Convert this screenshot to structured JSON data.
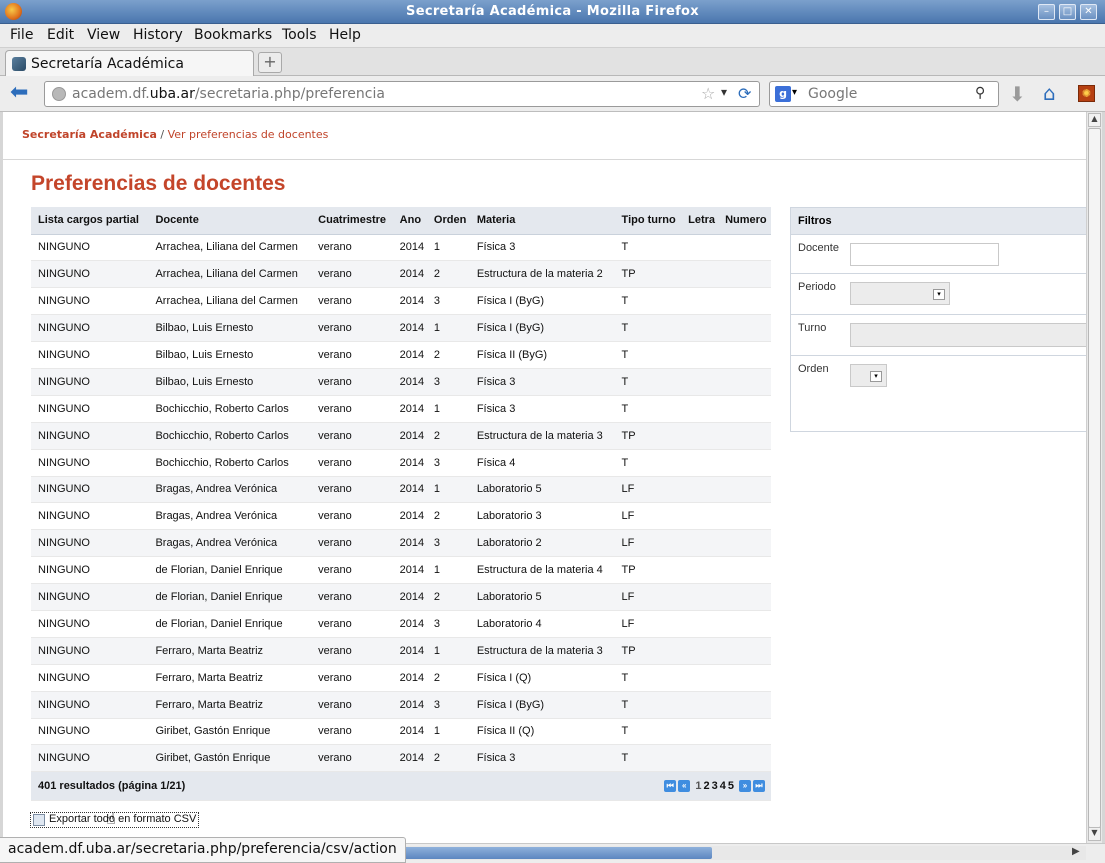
{
  "window": {
    "title": "Secretaría Académica - Mozilla Firefox"
  },
  "menu": [
    "File",
    "Edit",
    "View",
    "History",
    "Bookmarks",
    "Tools",
    "Help"
  ],
  "tab": {
    "title": "Secretaría Académica",
    "new_tab": "+"
  },
  "nav": {
    "url_prefix": "academ.df.",
    "url_host": "uba.ar",
    "url_path": "/secretaria.php/preferencia",
    "search_placeholder": "Google",
    "search_engine": "g"
  },
  "breadcrumb": {
    "root": "Secretaría Académica",
    "sep": " / ",
    "current": "Ver preferencias de docentes"
  },
  "page_title": "Preferencias de docentes",
  "table": {
    "columns": [
      "Lista cargos partial",
      "Docente",
      "Cuatrimestre",
      "Ano",
      "Orden",
      "Materia",
      "Tipo turno",
      "Letra",
      "Numero"
    ],
    "rows": [
      [
        "NINGUNO",
        "Arrachea, Liliana del Carmen",
        "verano",
        "2014",
        "1",
        "Física 3",
        "T",
        "",
        ""
      ],
      [
        "NINGUNO",
        "Arrachea, Liliana del Carmen",
        "verano",
        "2014",
        "2",
        "Estructura de la materia 2",
        "TP",
        "",
        ""
      ],
      [
        "NINGUNO",
        "Arrachea, Liliana del Carmen",
        "verano",
        "2014",
        "3",
        "Física I (ByG)",
        "T",
        "",
        ""
      ],
      [
        "NINGUNO",
        "Bilbao, Luis Ernesto",
        "verano",
        "2014",
        "1",
        "Física I (ByG)",
        "T",
        "",
        ""
      ],
      [
        "NINGUNO",
        "Bilbao, Luis Ernesto",
        "verano",
        "2014",
        "2",
        "Física II (ByG)",
        "T",
        "",
        ""
      ],
      [
        "NINGUNO",
        "Bilbao, Luis Ernesto",
        "verano",
        "2014",
        "3",
        "Física 3",
        "T",
        "",
        ""
      ],
      [
        "NINGUNO",
        "Bochicchio, Roberto Carlos",
        "verano",
        "2014",
        "1",
        "Física 3",
        "T",
        "",
        ""
      ],
      [
        "NINGUNO",
        "Bochicchio, Roberto Carlos",
        "verano",
        "2014",
        "2",
        "Estructura de la materia 3",
        "TP",
        "",
        ""
      ],
      [
        "NINGUNO",
        "Bochicchio, Roberto Carlos",
        "verano",
        "2014",
        "3",
        "Física 4",
        "T",
        "",
        ""
      ],
      [
        "NINGUNO",
        "Bragas, Andrea Verónica",
        "verano",
        "2014",
        "1",
        "Laboratorio 5",
        "LF",
        "",
        ""
      ],
      [
        "NINGUNO",
        "Bragas, Andrea Verónica",
        "verano",
        "2014",
        "2",
        "Laboratorio 3",
        "LF",
        "",
        ""
      ],
      [
        "NINGUNO",
        "Bragas, Andrea Verónica",
        "verano",
        "2014",
        "3",
        "Laboratorio 2",
        "LF",
        "",
        ""
      ],
      [
        "NINGUNO",
        "de Florian, Daniel Enrique",
        "verano",
        "2014",
        "1",
        "Estructura de la materia 4",
        "TP",
        "",
        ""
      ],
      [
        "NINGUNO",
        "de Florian, Daniel Enrique",
        "verano",
        "2014",
        "2",
        "Laboratorio 5",
        "LF",
        "",
        ""
      ],
      [
        "NINGUNO",
        "de Florian, Daniel Enrique",
        "verano",
        "2014",
        "3",
        "Laboratorio 4",
        "LF",
        "",
        ""
      ],
      [
        "NINGUNO",
        "Ferraro, Marta Beatriz",
        "verano",
        "2014",
        "1",
        "Estructura de la materia 3",
        "TP",
        "",
        ""
      ],
      [
        "NINGUNO",
        "Ferraro, Marta Beatriz",
        "verano",
        "2014",
        "2",
        "Física I (Q)",
        "T",
        "",
        ""
      ],
      [
        "NINGUNO",
        "Ferraro, Marta Beatriz",
        "verano",
        "2014",
        "3",
        "Física I (ByG)",
        "T",
        "",
        ""
      ],
      [
        "NINGUNO",
        "Giribet, Gastón Enrique",
        "verano",
        "2014",
        "1",
        "Física II (Q)",
        "T",
        "",
        ""
      ],
      [
        "NINGUNO",
        "Giribet, Gastón Enrique",
        "verano",
        "2014",
        "2",
        "Física 3",
        "T",
        "",
        ""
      ]
    ],
    "footer": "401 resultados (página 1/21)",
    "pages": [
      "1",
      "2",
      "3",
      "4",
      "5"
    ]
  },
  "filters": {
    "title": "Filtros",
    "docente_label": "Docente",
    "periodo_label": "Periodo",
    "turno_label": "Turno",
    "orden_label": "Orden",
    "docente_value": ""
  },
  "export_label": "Exportar todo en formato CSV",
  "status_url": "academ.df.uba.ar/secretaria.php/preferencia/csv/action",
  "colors": {
    "accent": "#c4452a",
    "header_bg": "#e4e8ee"
  }
}
